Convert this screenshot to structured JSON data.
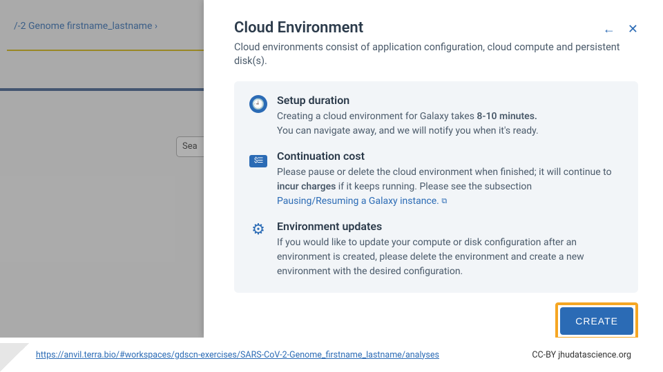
{
  "breadcrumb": "/-2 Genome firstname_lastname  ›",
  "search_snippet": "Sea",
  "panel": {
    "title": "Cloud Environment",
    "subtitle": "Cloud environments consist of application configuration, cloud compute and persistent disk(s).",
    "back_glyph": "←",
    "close_glyph": "✕"
  },
  "setup": {
    "heading": "Setup duration",
    "line1_a": "Creating a cloud environment for Galaxy takes ",
    "line1_b": "8-10 minutes.",
    "line2": "You can navigate away, and we will notify you when it's ready."
  },
  "cost": {
    "heading": "Continuation cost",
    "line_a": "Please pause or delete the cloud environment when finished; it will continue to ",
    "line_bold": "incur charges",
    "line_b": " if it keeps running. Please see the subsection ",
    "link_text": "Pausing/Resuming a Galaxy instance.",
    "ext_glyph": "⧉"
  },
  "updates": {
    "heading": "Environment updates",
    "text": "If you would like to update your compute or disk configuration after an environment is created, please delete the environment and create a new environment with the desired configuration."
  },
  "create_label": "CREATE",
  "footer": {
    "link": "https://anvil.terra.bio/#workspaces/gdscn-exercises/SARS-CoV-2-Genome_firstname_lastname/analyses",
    "attribution": "CC-BY  jhudatascience.org"
  },
  "icons": {
    "clock": "🕘",
    "cost": "$☰",
    "gear": "⚙"
  }
}
